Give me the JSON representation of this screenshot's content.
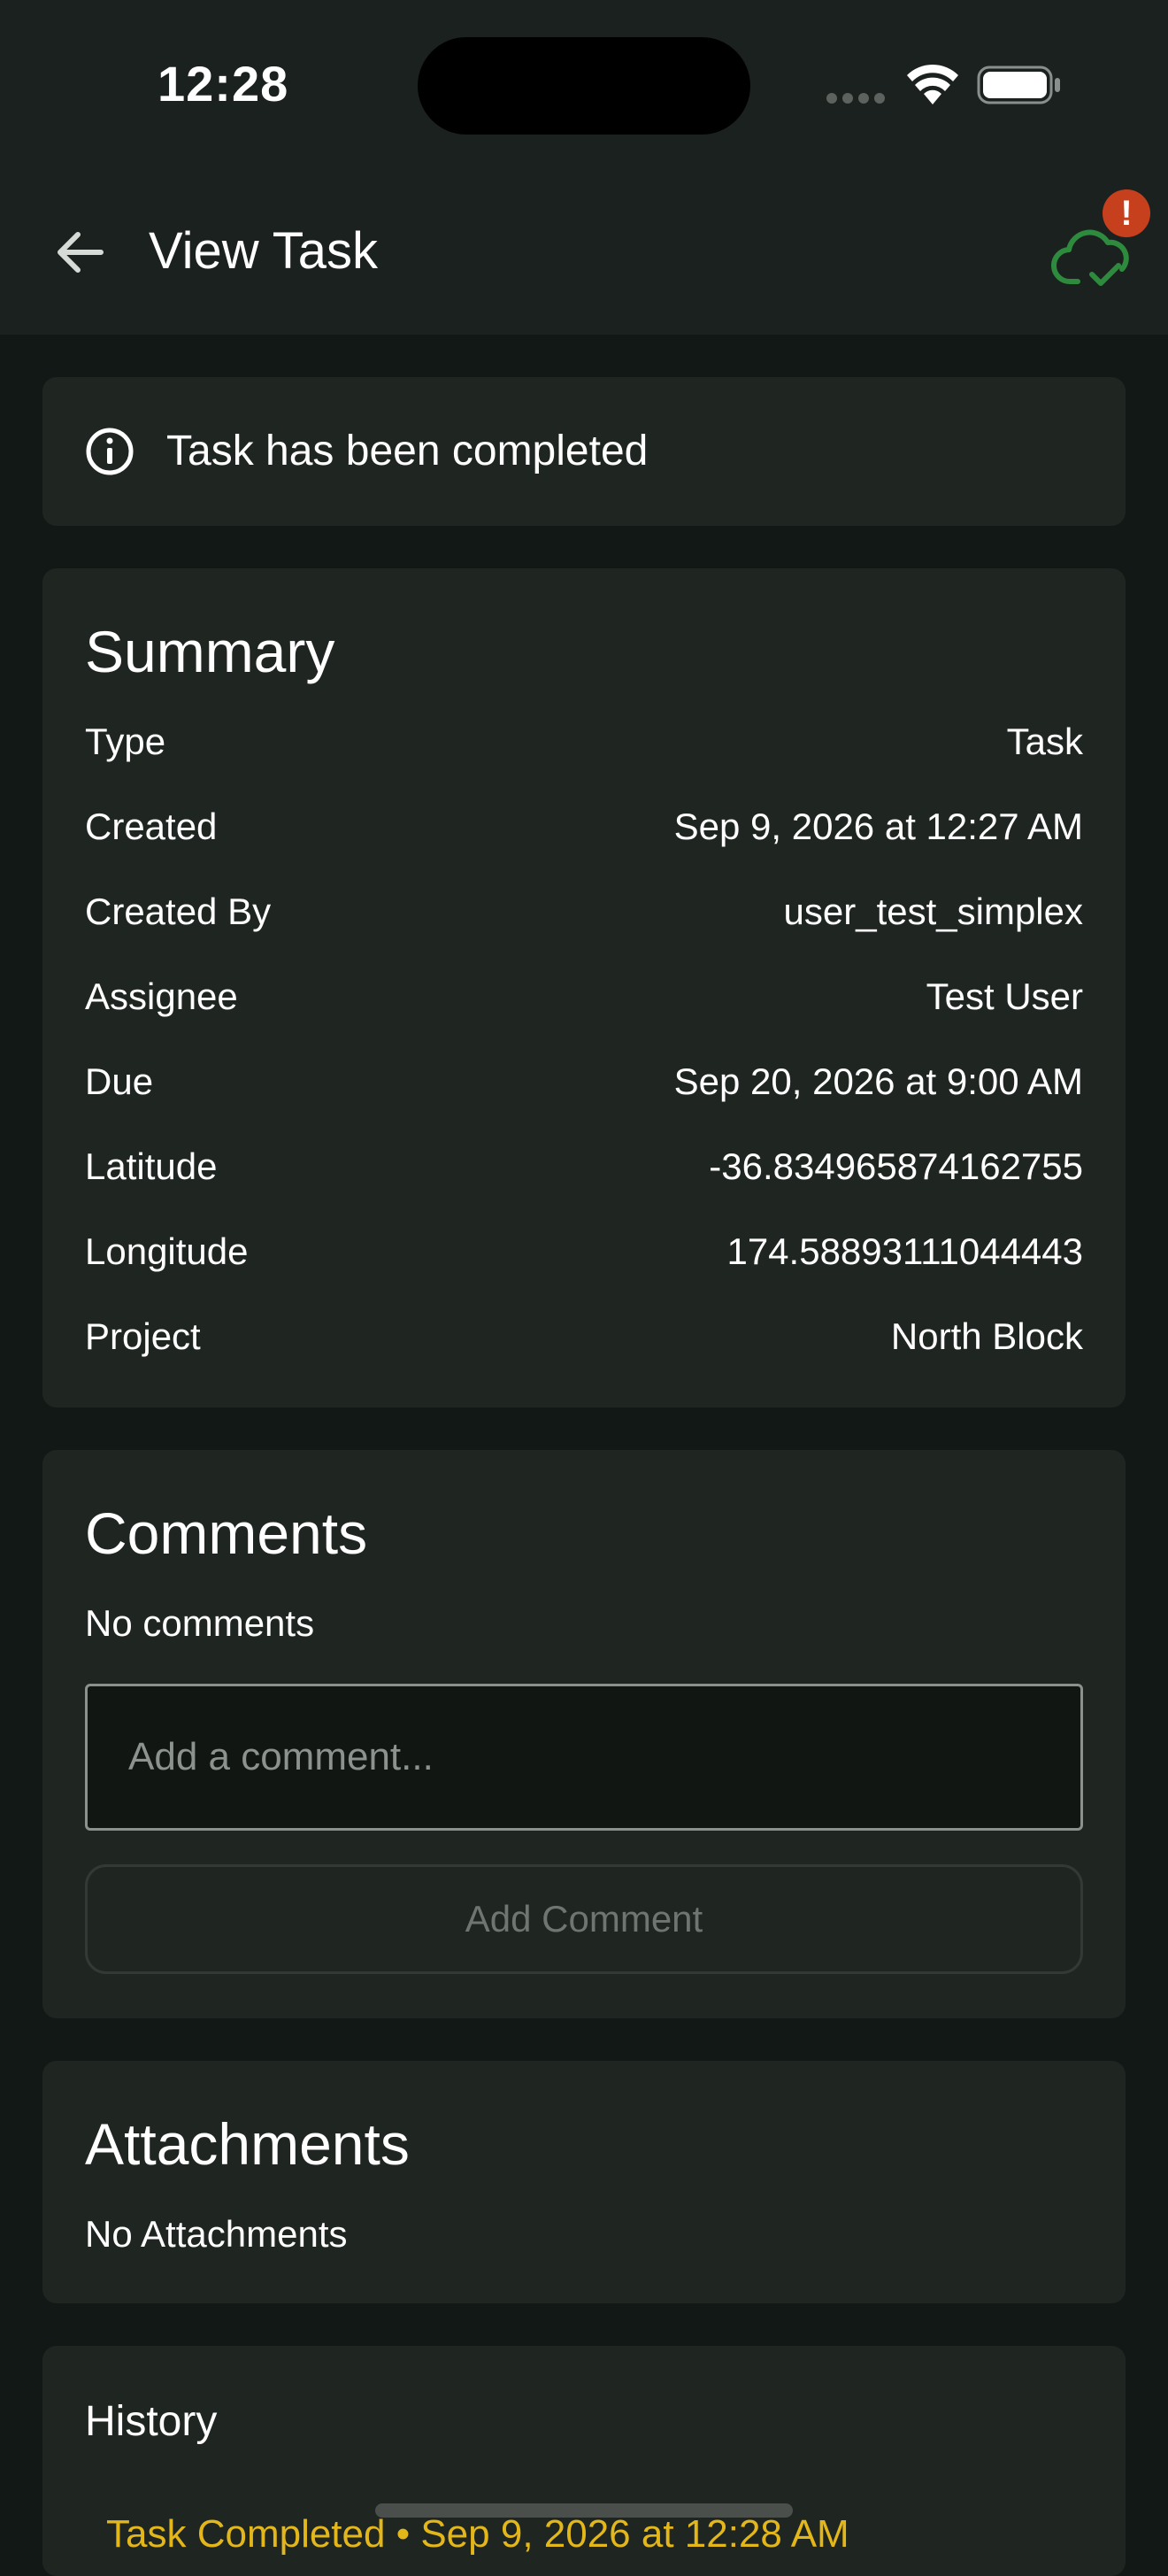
{
  "status_bar": {
    "time": "12:28"
  },
  "app_bar": {
    "title": "View Task",
    "sync_badge": "!",
    "sync_icon_color": "#2e8b3e",
    "badge_color": "#c7401e"
  },
  "banner": {
    "message": "Task has been completed"
  },
  "summary": {
    "title": "Summary",
    "rows": [
      {
        "label": "Type",
        "value": "Task"
      },
      {
        "label": "Created",
        "value": "Sep 9, 2026 at 12:27 AM"
      },
      {
        "label": "Created By",
        "value": "user_test_simplex"
      },
      {
        "label": "Assignee",
        "value": "Test User"
      },
      {
        "label": "Due",
        "value": "Sep 20, 2026 at 9:00 AM"
      },
      {
        "label": "Latitude",
        "value": "-36.834965874162755"
      },
      {
        "label": "Longitude",
        "value": "174.58893111044443"
      },
      {
        "label": "Project",
        "value": "North Block"
      }
    ]
  },
  "comments": {
    "title": "Comments",
    "empty_text": "No comments",
    "input_placeholder": "Add a comment...",
    "add_button": "Add Comment"
  },
  "attachments": {
    "title": "Attachments",
    "empty_text": "No Attachments"
  },
  "history": {
    "title": "History",
    "entries": [
      {
        "text": "Task Completed  •  Sep 9, 2026 at 12:28 AM",
        "color": "#e3b71a"
      }
    ]
  }
}
